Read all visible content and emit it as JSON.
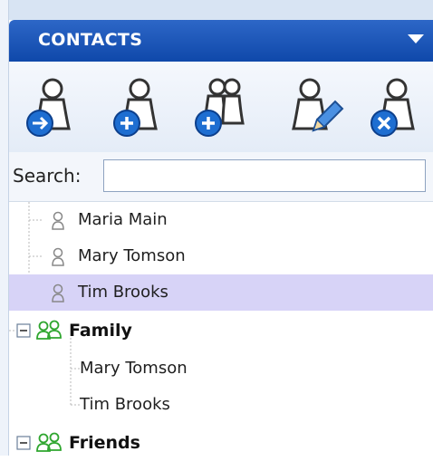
{
  "header": {
    "title": "CONTACTS"
  },
  "toolbar": {
    "buttons": [
      {
        "name": "view-contact"
      },
      {
        "name": "add-contact"
      },
      {
        "name": "add-group"
      },
      {
        "name": "edit-contact"
      },
      {
        "name": "delete-contact"
      }
    ]
  },
  "search": {
    "label": "Search:",
    "value": "",
    "placeholder": ""
  },
  "tree": {
    "contacts": [
      "Maria Main",
      "Mary Tomson",
      "Tim Brooks"
    ],
    "selected": "Tim Brooks",
    "groups": [
      {
        "name": "Family",
        "members": [
          "Mary Tomson",
          "Tim Brooks"
        ],
        "expanded": true
      },
      {
        "name": "Friends",
        "members": [],
        "expanded": true
      }
    ]
  },
  "colors": {
    "header_blue": "#1a55b8",
    "icon_blue": "#1e6ed1",
    "group_green": "#2fa62f",
    "selected_row": "#d7d3f7"
  }
}
